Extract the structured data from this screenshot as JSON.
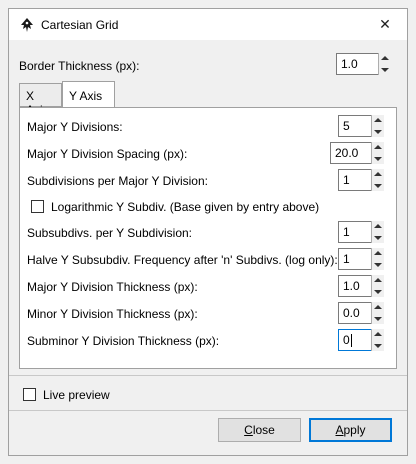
{
  "window": {
    "title": "Cartesian Grid",
    "close_glyph": "✕"
  },
  "border": {
    "label": "Border Thickness (px):",
    "value": "1.0"
  },
  "tabs": [
    {
      "label": "X Axis",
      "active": false
    },
    {
      "label": "Y Axis",
      "active": true
    }
  ],
  "fields": [
    {
      "label": "Major Y Divisions:",
      "value": "5"
    },
    {
      "label": "Major Y Division Spacing (px):",
      "value": "20.0"
    },
    {
      "label": "Subdivisions per Major Y Division:",
      "value": "1"
    },
    {
      "label": "Logarithmic Y Subdiv. (Base given by entry above)",
      "checked": false
    },
    {
      "label": "Subsubdivs. per Y Subdivision:",
      "value": "1"
    },
    {
      "label": "Halve Y Subsubdiv. Frequency after 'n' Subdivs. (log only):",
      "value": "1"
    },
    {
      "label": "Major Y Division Thickness (px):",
      "value": "1.0"
    },
    {
      "label": "Minor Y Division Thickness (px):",
      "value": "0.0"
    },
    {
      "label": "Subminor Y Division Thickness (px):",
      "value": "0"
    }
  ],
  "live_preview": {
    "label": "Live preview",
    "checked": false
  },
  "buttons": {
    "close_first": "C",
    "close_rest": "lose",
    "apply_first": "A",
    "apply_rest": "pply"
  }
}
